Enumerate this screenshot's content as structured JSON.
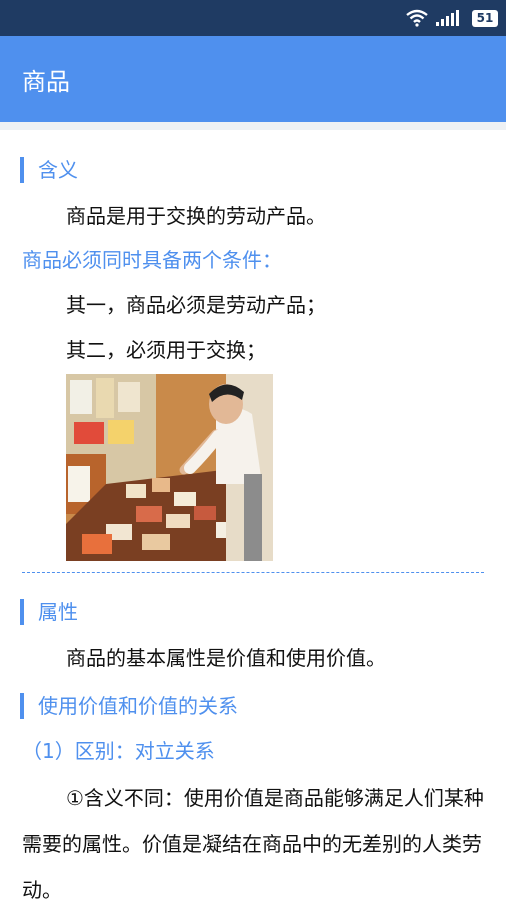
{
  "status_bar": {
    "battery": "51",
    "icons": [
      "wifi-icon",
      "signal-icon",
      "battery-icon"
    ],
    "background": "#1f3b63"
  },
  "app_bar": {
    "title": "商品",
    "background": "#4f90ee"
  },
  "sections": {
    "meaning": {
      "heading": "含义",
      "definition": "商品是用于交换的劳动产品。",
      "conditions_title": "商品必须同时具备两个条件：",
      "condition_1": "其一，商品必须是劳动产品；",
      "condition_2": "其二，必须用于交换；"
    },
    "attributes": {
      "heading": "属性",
      "text": "商品的基本属性是价值和使用价值。"
    },
    "relation": {
      "heading": "使用价值和价值的关系",
      "subheading": "（1）区别：对立关系",
      "paragraph": "①含义不同：使用价值是商品能够满足人们某种需要的属性。价值是凝结在商品中的无差别的人类劳动。"
    }
  },
  "accent_color": "#4f90ee"
}
